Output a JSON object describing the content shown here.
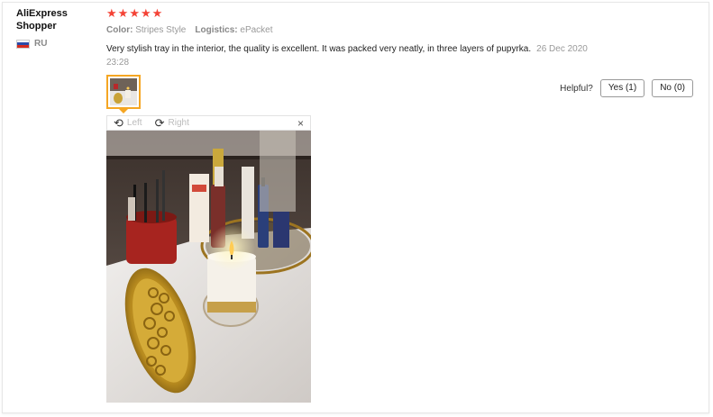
{
  "review": {
    "user": {
      "name": "AliExpress Shopper",
      "country_code": "RU",
      "flag_icon": "russia-flag-icon"
    },
    "rating": {
      "stars": 5,
      "max": 5,
      "star_glyph": "★",
      "color": "#f44336"
    },
    "attributes": {
      "color_label": "Color:",
      "color_value": "Stripes Style",
      "logistics_label": "Logistics:",
      "logistics_value": "ePacket"
    },
    "text": "Very stylish tray in the interior, the quality is excellent. It was packed very neatly, in three layers of pupyrka.",
    "date": "26 Dec 2020 23:28",
    "helpful": {
      "label": "Helpful?",
      "yes_label": "Yes (1)",
      "no_label": "No (0)"
    },
    "viewer": {
      "rotate_left_label": "Left",
      "rotate_right_label": "Right",
      "rotate_left_icon": "rotate-left-icon",
      "rotate_right_icon": "rotate-right-icon",
      "close_icon": "close-icon",
      "close_glyph": "×"
    }
  },
  "colors": {
    "accent_border": "#f5a623",
    "star": "#f44336",
    "muted_text": "#999999"
  }
}
